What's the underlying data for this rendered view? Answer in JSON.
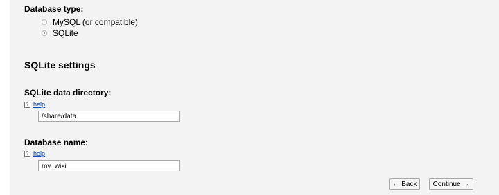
{
  "form": {
    "database_type": {
      "label": "Database type:",
      "options": [
        {
          "label": "MySQL (or compatible)",
          "checked": false
        },
        {
          "label": "SQLite",
          "checked": true
        }
      ]
    },
    "section_heading": "SQLite settings",
    "data_directory": {
      "label": "SQLite data directory:",
      "help_marker": "?",
      "help_label": "help",
      "value": "/share/data"
    },
    "database_name": {
      "label": "Database name:",
      "help_marker": "?",
      "help_label": "help",
      "value": "my_wiki"
    },
    "buttons": {
      "back": "← Back",
      "continue": "Continue →"
    }
  },
  "colors": {
    "panel_background": "#f3f3f3",
    "link": "#0645ad"
  }
}
